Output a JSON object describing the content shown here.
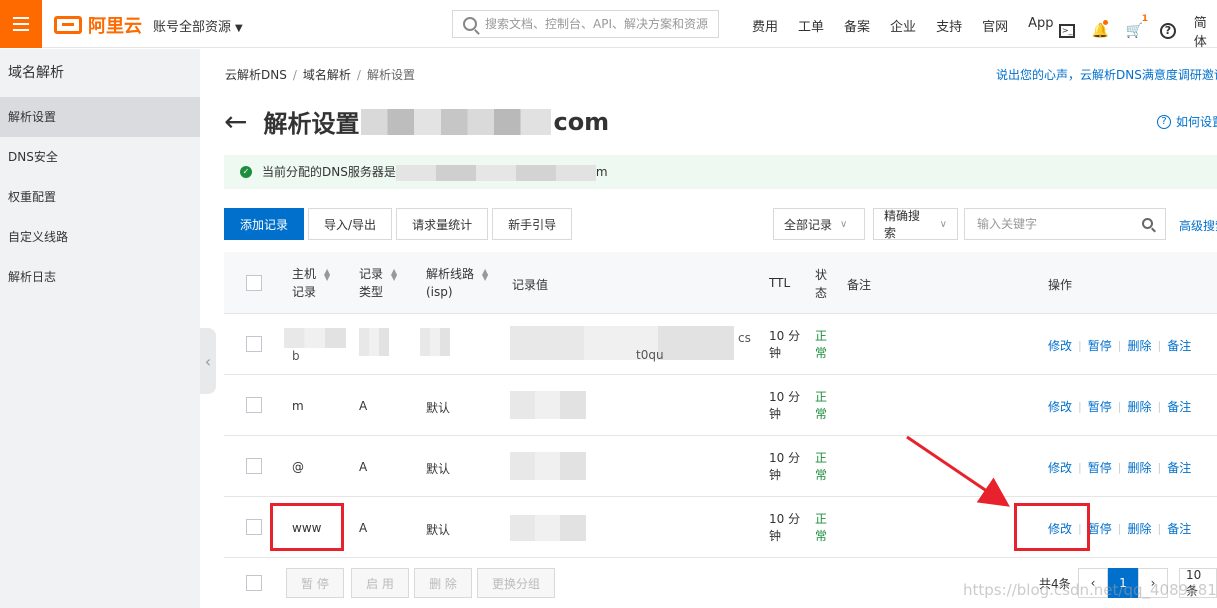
{
  "header": {
    "logo_text": "阿里云",
    "account_label": "账号全部资源",
    "search_placeholder": "搜索文档、控制台、API、解决方案和资源",
    "nav": [
      "费用",
      "工单",
      "备案",
      "企业",
      "支持",
      "官网",
      "App"
    ],
    "cart_badge": "1",
    "lang_label": "简体"
  },
  "sidebar": {
    "title": "域名解析",
    "items": [
      {
        "label": "解析设置",
        "active": true
      },
      {
        "label": "DNS安全",
        "active": false
      },
      {
        "label": "权重配置",
        "active": false
      },
      {
        "label": "自定义线路",
        "active": false
      },
      {
        "label": "解析日志",
        "active": false
      }
    ]
  },
  "breadcrumb": [
    "云解析DNS",
    "域名解析",
    "解析设置"
  ],
  "feedback_link": "说出您的心声，云解析DNS满意度调研邀请",
  "page": {
    "title_prefix": "解析设置",
    "domain_suffix": "com",
    "howto_link": "如何设置"
  },
  "notice": {
    "text_prefix": "当前分配的DNS服务器是",
    "text_suffix": "m"
  },
  "toolbar": {
    "add_record": "添加记录",
    "import_export": "导入/导出",
    "request_stats": "请求量统计",
    "beginner_guide": "新手引导",
    "filter_all": "全部记录",
    "filter_exact": "精确搜索",
    "keyword_placeholder": "输入关键字",
    "advanced_search": "高级搜索"
  },
  "table": {
    "headers": {
      "host_l1": "主机",
      "host_l2": "记录",
      "type_l1": "记录",
      "type_l2": "类型",
      "line_l1": "解析线路",
      "line_l2": "(isp)",
      "value": "记录值",
      "ttl": "TTL",
      "status_l1": "状",
      "status_l2": "态",
      "remark": "备注",
      "actions": "操作"
    },
    "rows": [
      {
        "host": "b",
        "type": "",
        "line": "",
        "value_tail": "cs",
        "value_tail2": "t0qu",
        "ttl_l1": "10 分",
        "ttl_l2": "钟",
        "status_l1": "正",
        "status_l2": "常"
      },
      {
        "host": "m",
        "type": "A",
        "line": "默认",
        "ttl_l1": "10 分",
        "ttl_l2": "钟",
        "status_l1": "正",
        "status_l2": "常"
      },
      {
        "host": "@",
        "type": "A",
        "line": "默认",
        "ttl_l1": "10 分",
        "ttl_l2": "钟",
        "status_l1": "正",
        "status_l2": "常"
      },
      {
        "host": "www",
        "type": "A",
        "line": "默认",
        "ttl_l1": "10 分",
        "ttl_l2": "钟",
        "status_l1": "正",
        "status_l2": "常"
      }
    ],
    "actions": {
      "edit": "修改",
      "pause": "暂停",
      "delete": "删除",
      "remark": "备注"
    }
  },
  "footer": {
    "pause": "暂 停",
    "enable": "启 用",
    "delete": "删 除",
    "change_group": "更换分组",
    "total": "共4条",
    "page": "1",
    "page_size": "10 条"
  },
  "watermark": "https://blog.csdn.net/qq_40894812",
  "colors": {
    "brand": "#ff6a00",
    "primary": "#0070cc",
    "annotation": "#e8222c",
    "status_ok": "#1e8e3e"
  }
}
